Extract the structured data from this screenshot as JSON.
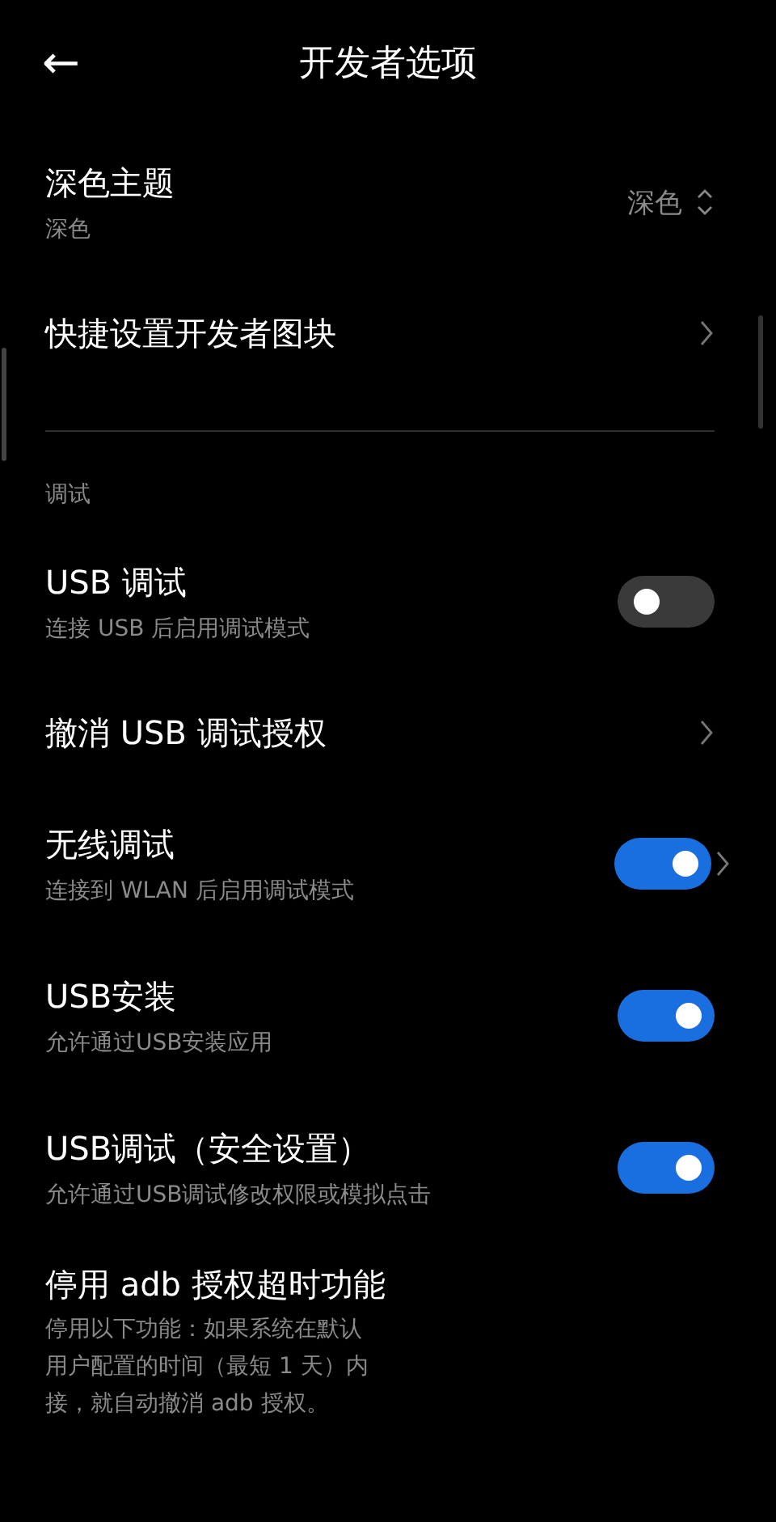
{
  "header": {
    "back": "←",
    "title": "开发者选项"
  },
  "top_items": [
    {
      "kind": "value",
      "title": "深色主题",
      "subtitle": "深色",
      "value": "深色"
    },
    {
      "kind": "link",
      "title": "快捷设置开发者图块"
    }
  ],
  "section": {
    "title": "调试",
    "items": [
      {
        "kind": "switch",
        "title": "USB 调试",
        "subtitle": "连接 USB 后启用调试模式",
        "on": false
      },
      {
        "kind": "link",
        "title": "撤消 USB 调试授权"
      },
      {
        "kind": "switch_link",
        "title": "无线调试",
        "subtitle": "连接到 WLAN 后启用调试模式",
        "on": true
      },
      {
        "kind": "switch",
        "title": "USB安装",
        "subtitle": "允许通过USB安装应用",
        "on": true
      },
      {
        "kind": "switch",
        "title": "USB调试（安全设置）",
        "subtitle": "允许通过USB调试修改权限或模拟点击",
        "on": true
      },
      {
        "kind": "lines",
        "title": "停用 adb 授权超时功能",
        "lines": [
          "停用以下功能：如果系统在默认",
          "用户配置的时间（最短 1 天）内",
          "接，就自动撤消 adb 授权。"
        ]
      }
    ]
  }
}
